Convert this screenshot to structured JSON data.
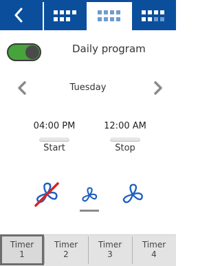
{
  "header": {
    "tabs": [
      {
        "name": "schedule-view-1",
        "active": false
      },
      {
        "name": "schedule-view-2",
        "active": true
      },
      {
        "name": "schedule-view-3",
        "active": false
      }
    ]
  },
  "program": {
    "title": "Daily program",
    "enabled": true,
    "day": "Tuesday"
  },
  "times": {
    "start_value": "04:00 PM",
    "start_label": "Start",
    "stop_value": "12:00 AM",
    "stop_label": "Stop"
  },
  "fan": {
    "selected": "low",
    "modes": [
      "off",
      "low",
      "high"
    ]
  },
  "timers": [
    {
      "label": "Timer",
      "num": "1",
      "active": true
    },
    {
      "label": "Timer",
      "num": "2",
      "active": false
    },
    {
      "label": "Timer",
      "num": "3",
      "active": false
    },
    {
      "label": "Timer",
      "num": "4",
      "active": false
    }
  ],
  "colors": {
    "header": "#0b4f9c",
    "toggle_on": "#47a33c",
    "accent_blue": "#1f5fbf",
    "off_slash": "#e02020"
  }
}
